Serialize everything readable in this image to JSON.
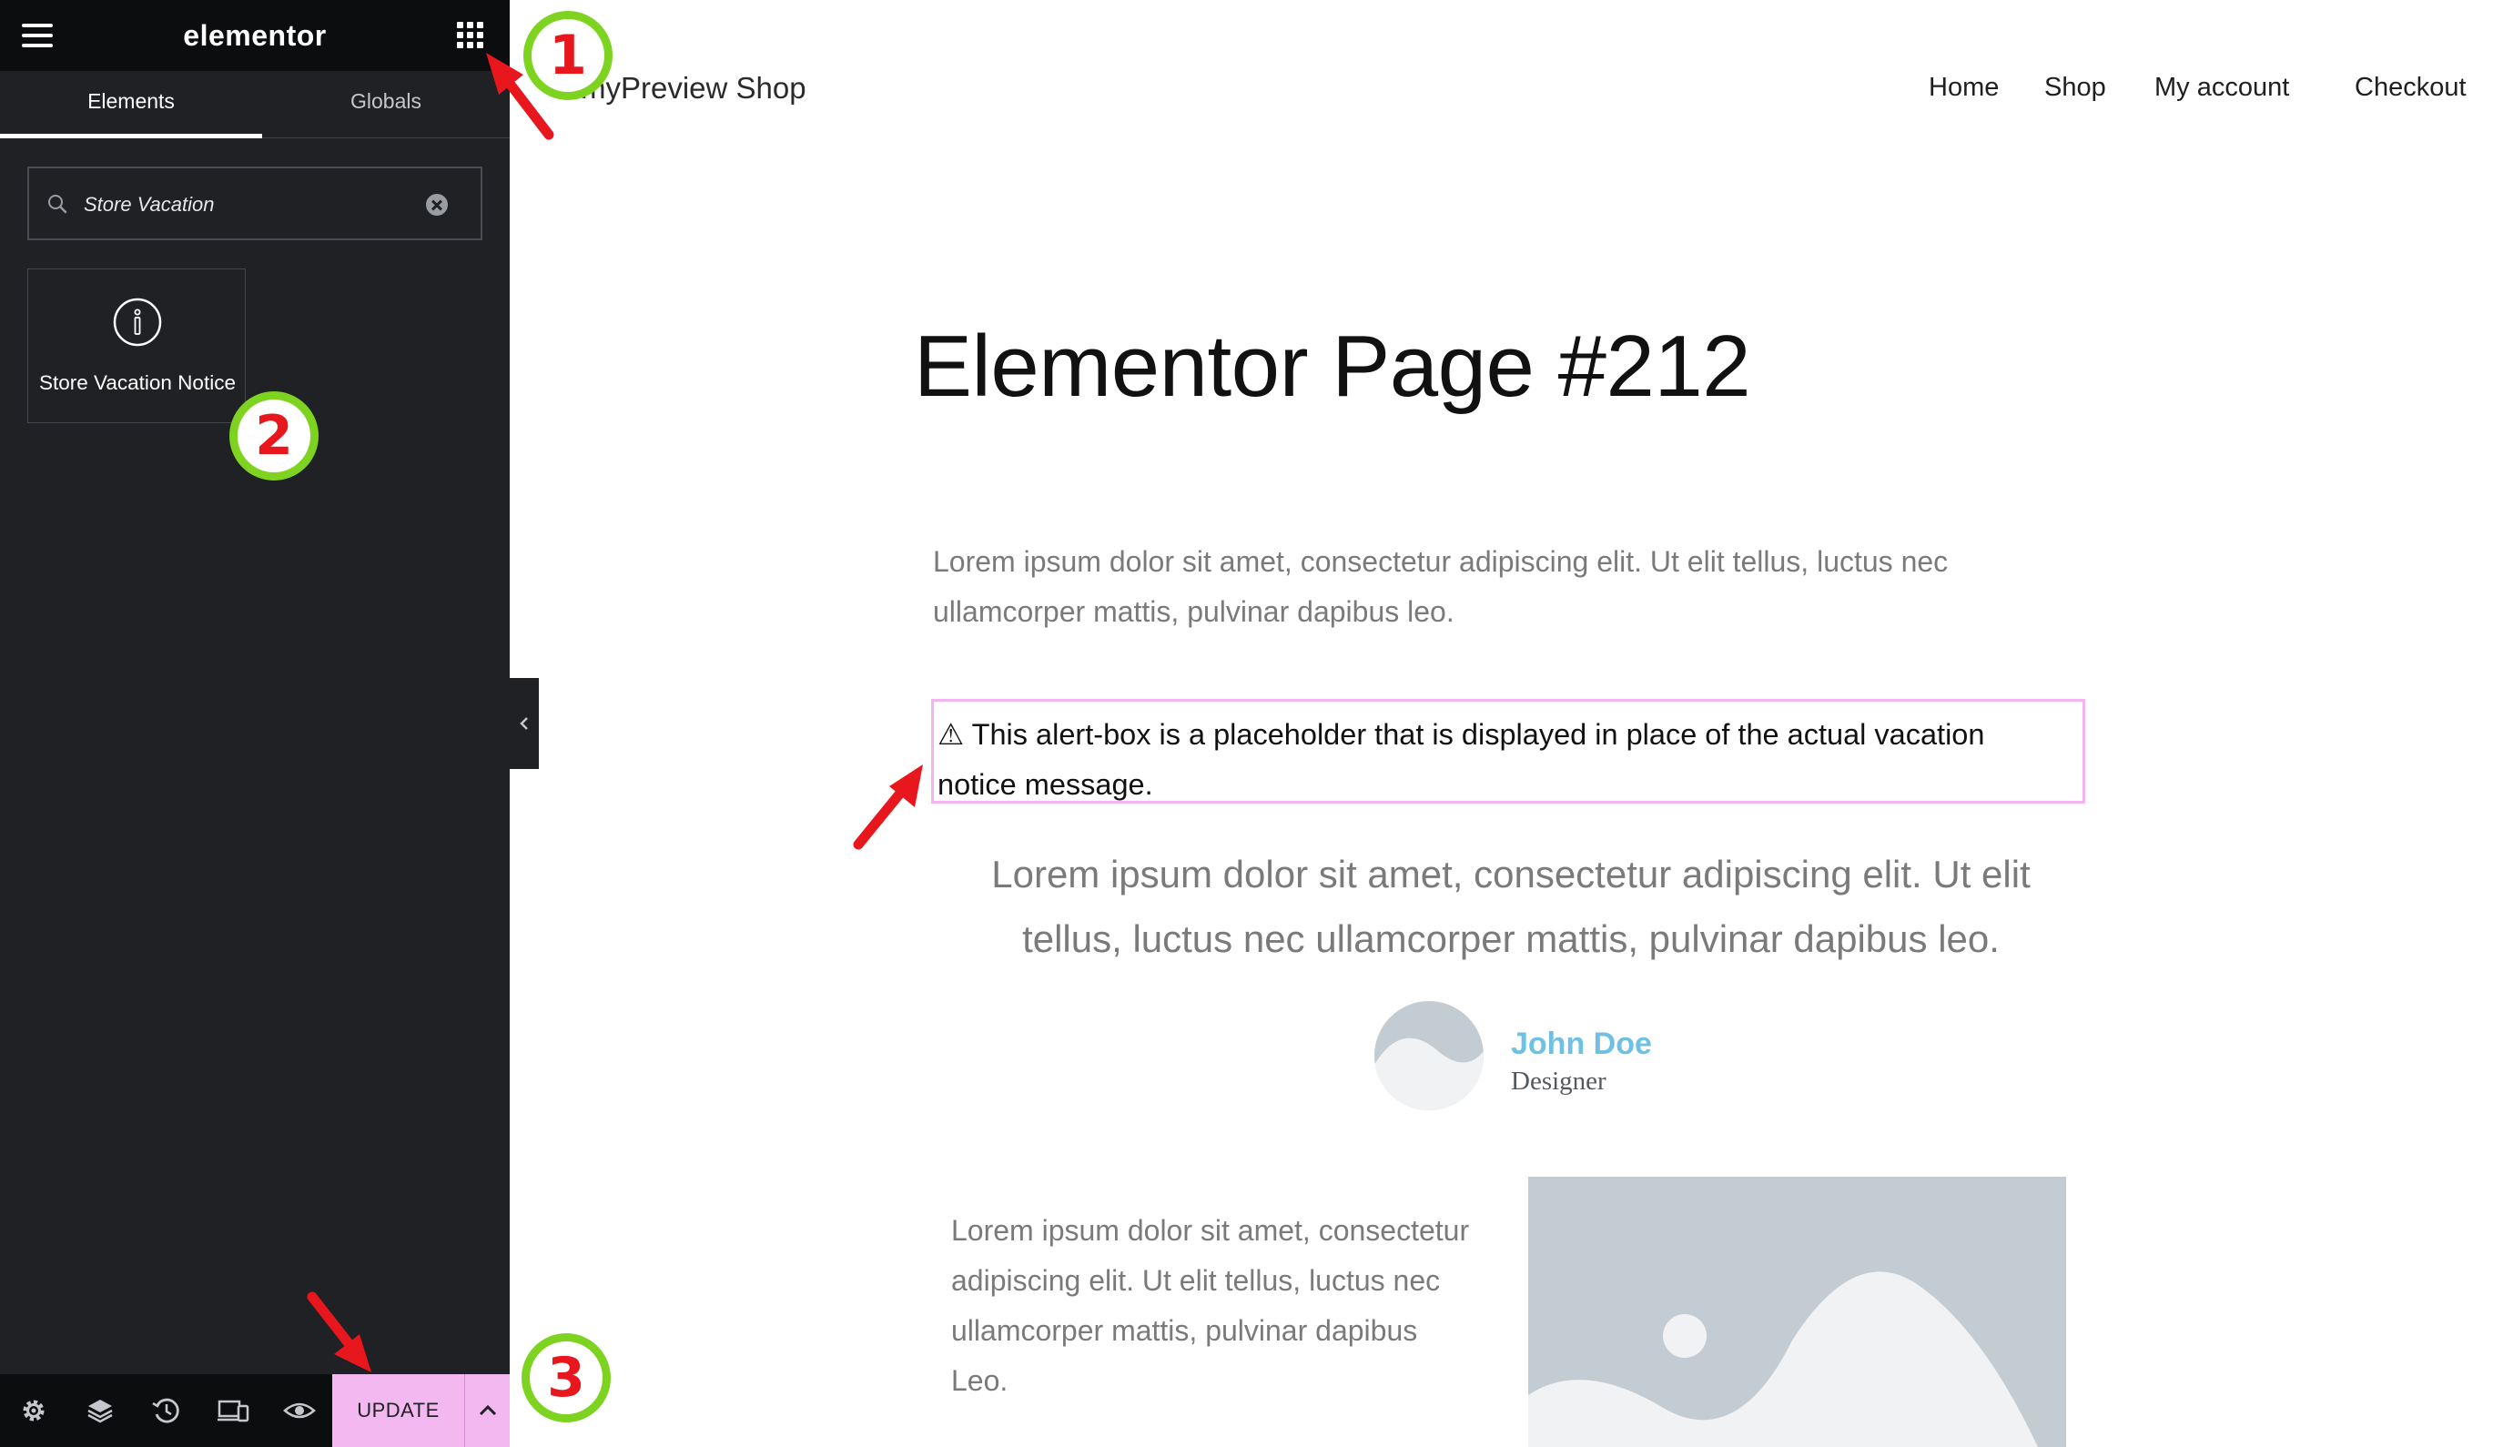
{
  "editor": {
    "logo": "elementor",
    "tabs": {
      "elements": "Elements",
      "globals": "Globals"
    },
    "search": {
      "value": "Store Vacation"
    },
    "widget": {
      "label": "Store Vacation Notice",
      "icon": "info-circle-icon"
    },
    "footer": {
      "icons": [
        "settings-icon",
        "layers-icon",
        "history-icon",
        "responsive-icon",
        "preview-eye-icon"
      ],
      "update_label": "UPDATE"
    }
  },
  "site": {
    "title": "myPreview Shop",
    "nav": {
      "home": "Home",
      "shop": "Shop",
      "account": "My account",
      "checkout": "Checkout"
    }
  },
  "page": {
    "title": "Elementor Page #212",
    "intro": "Lorem ipsum dolor sit amet, consectetur adipiscing elit. Ut elit tellus, luctus nec ullamcorper mattis, pulvinar dapibus leo.",
    "alert_icon": "⚠",
    "alert_text": "This alert-box is a placeholder that is displayed in place of the actual vacation notice message.",
    "quote": "Lorem ipsum dolor sit amet, consectetur adipiscing elit. Ut elit tellus, luctus nec ullamcorper mattis, pulvinar dapibus leo.",
    "author": {
      "name": "John Doe",
      "role": "Designer"
    },
    "body": "Lorem ipsum dolor sit amet, consectetur adipiscing elit. Ut elit tellus, luctus nec ullamcorper mattis, pulvinar dapibus Leo."
  },
  "annotations": {
    "step1": "1",
    "step2": "2",
    "step3": "3"
  },
  "colors": {
    "annotation_ring": "#7ed321",
    "annotation_number": "#e8161d",
    "update_button": "#f2b8ef",
    "alert_border": "#f5b4f1",
    "author_name": "#6ec1e4"
  }
}
